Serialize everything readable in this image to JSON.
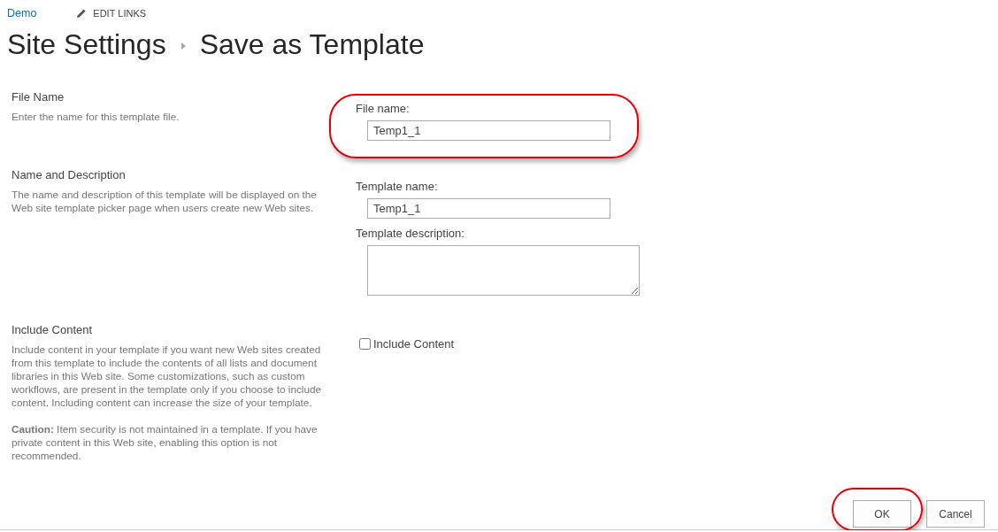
{
  "top_nav": {
    "site_link": "Demo",
    "edit_links": "EDIT LINKS"
  },
  "page_title": {
    "breadcrumb": [
      "Site Settings",
      "Save as Template"
    ]
  },
  "sections": [
    {
      "title": "File Name",
      "description": "Enter the name for this template file.",
      "highlighted": true,
      "fields": [
        {
          "kind": "input",
          "label": "File name:",
          "value": "Temp1_1"
        }
      ]
    },
    {
      "title": "Name and Description",
      "description": "The name and description of this template will be displayed on the Web site template picker page when users create new Web sites.",
      "highlighted": false,
      "fields": [
        {
          "kind": "input",
          "label": "Template name:",
          "value": "Temp1_1"
        },
        {
          "kind": "textarea",
          "label": "Template description:"
        }
      ]
    },
    {
      "title": "Include Content",
      "description": "Include content in your template if you want new Web sites created from this template to include the contents of all lists and document libraries in this Web site. Some customizations, such as custom workflows, are present in the template only if you choose to include content. Including content can increase the size of your template.",
      "note": "**Caution:** Item security is not maintained in a template. If you have private content in this Web site, enabling this option is not recommended.",
      "highlighted": false,
      "fields": [
        {
          "kind": "checkbox",
          "label": "Include Content",
          "checked": false
        }
      ]
    }
  ],
  "buttons": [
    {
      "label": "OK",
      "highlighted": true
    },
    {
      "label": "Cancel",
      "highlighted": false
    }
  ]
}
